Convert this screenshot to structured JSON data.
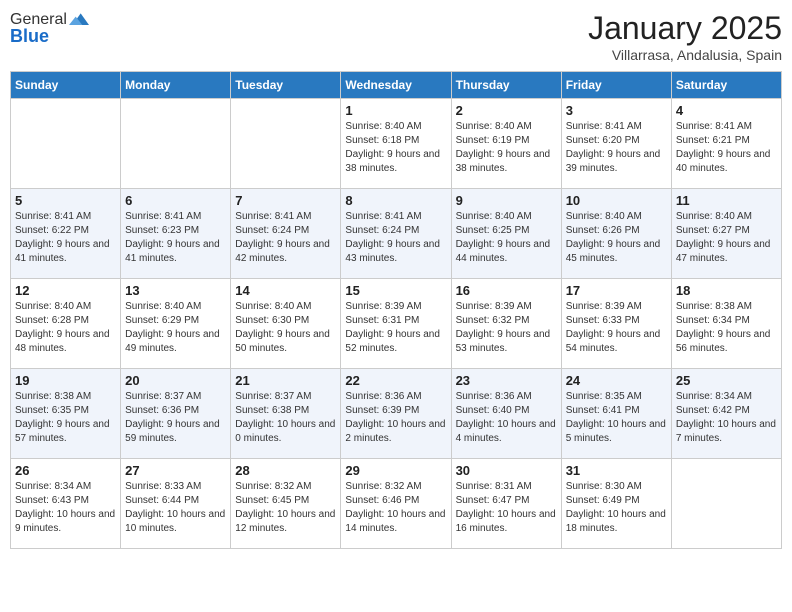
{
  "header": {
    "logo_line1": "General",
    "logo_line2": "Blue",
    "month_title": "January 2025",
    "location": "Villarrasa, Andalusia, Spain"
  },
  "days_of_week": [
    "Sunday",
    "Monday",
    "Tuesday",
    "Wednesday",
    "Thursday",
    "Friday",
    "Saturday"
  ],
  "weeks": [
    [
      {
        "day": "",
        "info": ""
      },
      {
        "day": "",
        "info": ""
      },
      {
        "day": "",
        "info": ""
      },
      {
        "day": "1",
        "info": "Sunrise: 8:40 AM\nSunset: 6:18 PM\nDaylight: 9 hours and 38 minutes."
      },
      {
        "day": "2",
        "info": "Sunrise: 8:40 AM\nSunset: 6:19 PM\nDaylight: 9 hours and 38 minutes."
      },
      {
        "day": "3",
        "info": "Sunrise: 8:41 AM\nSunset: 6:20 PM\nDaylight: 9 hours and 39 minutes."
      },
      {
        "day": "4",
        "info": "Sunrise: 8:41 AM\nSunset: 6:21 PM\nDaylight: 9 hours and 40 minutes."
      }
    ],
    [
      {
        "day": "5",
        "info": "Sunrise: 8:41 AM\nSunset: 6:22 PM\nDaylight: 9 hours and 41 minutes."
      },
      {
        "day": "6",
        "info": "Sunrise: 8:41 AM\nSunset: 6:23 PM\nDaylight: 9 hours and 41 minutes."
      },
      {
        "day": "7",
        "info": "Sunrise: 8:41 AM\nSunset: 6:24 PM\nDaylight: 9 hours and 42 minutes."
      },
      {
        "day": "8",
        "info": "Sunrise: 8:41 AM\nSunset: 6:24 PM\nDaylight: 9 hours and 43 minutes."
      },
      {
        "day": "9",
        "info": "Sunrise: 8:40 AM\nSunset: 6:25 PM\nDaylight: 9 hours and 44 minutes."
      },
      {
        "day": "10",
        "info": "Sunrise: 8:40 AM\nSunset: 6:26 PM\nDaylight: 9 hours and 45 minutes."
      },
      {
        "day": "11",
        "info": "Sunrise: 8:40 AM\nSunset: 6:27 PM\nDaylight: 9 hours and 47 minutes."
      }
    ],
    [
      {
        "day": "12",
        "info": "Sunrise: 8:40 AM\nSunset: 6:28 PM\nDaylight: 9 hours and 48 minutes."
      },
      {
        "day": "13",
        "info": "Sunrise: 8:40 AM\nSunset: 6:29 PM\nDaylight: 9 hours and 49 minutes."
      },
      {
        "day": "14",
        "info": "Sunrise: 8:40 AM\nSunset: 6:30 PM\nDaylight: 9 hours and 50 minutes."
      },
      {
        "day": "15",
        "info": "Sunrise: 8:39 AM\nSunset: 6:31 PM\nDaylight: 9 hours and 52 minutes."
      },
      {
        "day": "16",
        "info": "Sunrise: 8:39 AM\nSunset: 6:32 PM\nDaylight: 9 hours and 53 minutes."
      },
      {
        "day": "17",
        "info": "Sunrise: 8:39 AM\nSunset: 6:33 PM\nDaylight: 9 hours and 54 minutes."
      },
      {
        "day": "18",
        "info": "Sunrise: 8:38 AM\nSunset: 6:34 PM\nDaylight: 9 hours and 56 minutes."
      }
    ],
    [
      {
        "day": "19",
        "info": "Sunrise: 8:38 AM\nSunset: 6:35 PM\nDaylight: 9 hours and 57 minutes."
      },
      {
        "day": "20",
        "info": "Sunrise: 8:37 AM\nSunset: 6:36 PM\nDaylight: 9 hours and 59 minutes."
      },
      {
        "day": "21",
        "info": "Sunrise: 8:37 AM\nSunset: 6:38 PM\nDaylight: 10 hours and 0 minutes."
      },
      {
        "day": "22",
        "info": "Sunrise: 8:36 AM\nSunset: 6:39 PM\nDaylight: 10 hours and 2 minutes."
      },
      {
        "day": "23",
        "info": "Sunrise: 8:36 AM\nSunset: 6:40 PM\nDaylight: 10 hours and 4 minutes."
      },
      {
        "day": "24",
        "info": "Sunrise: 8:35 AM\nSunset: 6:41 PM\nDaylight: 10 hours and 5 minutes."
      },
      {
        "day": "25",
        "info": "Sunrise: 8:34 AM\nSunset: 6:42 PM\nDaylight: 10 hours and 7 minutes."
      }
    ],
    [
      {
        "day": "26",
        "info": "Sunrise: 8:34 AM\nSunset: 6:43 PM\nDaylight: 10 hours and 9 minutes."
      },
      {
        "day": "27",
        "info": "Sunrise: 8:33 AM\nSunset: 6:44 PM\nDaylight: 10 hours and 10 minutes."
      },
      {
        "day": "28",
        "info": "Sunrise: 8:32 AM\nSunset: 6:45 PM\nDaylight: 10 hours and 12 minutes."
      },
      {
        "day": "29",
        "info": "Sunrise: 8:32 AM\nSunset: 6:46 PM\nDaylight: 10 hours and 14 minutes."
      },
      {
        "day": "30",
        "info": "Sunrise: 8:31 AM\nSunset: 6:47 PM\nDaylight: 10 hours and 16 minutes."
      },
      {
        "day": "31",
        "info": "Sunrise: 8:30 AM\nSunset: 6:49 PM\nDaylight: 10 hours and 18 minutes."
      },
      {
        "day": "",
        "info": ""
      }
    ]
  ]
}
